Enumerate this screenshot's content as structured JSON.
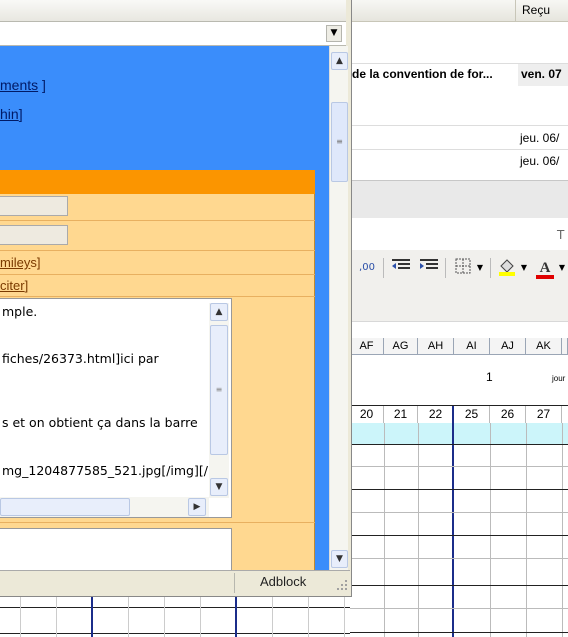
{
  "mail": {
    "col_recu": "Reçu",
    "rows": [
      {
        "subject": "de la convention de for...",
        "date": "ven. 07",
        "bold": true
      },
      {
        "subject": "",
        "date": "jeu. 06/",
        "bold": false
      },
      {
        "subject": "",
        "date": "jeu. 06/",
        "bold": false
      }
    ]
  },
  "spreadsheet": {
    "toolbar_partial_label": "T",
    "columns": [
      "AF",
      "AG",
      "AH",
      "AI",
      "AJ",
      "AK"
    ],
    "row_value": "1",
    "row_value_label": "jour",
    "days": [
      "20",
      "21",
      "22",
      "25",
      "26",
      "27"
    ]
  },
  "dialog": {
    "blue_links": [
      {
        "text": "ments",
        "suffix": " ]"
      },
      {
        "text": "hin",
        "suffix": "]"
      }
    ],
    "orange_links": [
      {
        "text": "miley",
        "suffix": "s]"
      },
      {
        "text": "citer",
        "suffix": "]"
      }
    ],
    "textarea_lines": [
      "mple.",
      "fiches/26373.html]ici par",
      "s et on obtient ça dans la barre",
      "mg_1204877585_521.jpg[/img][/"
    ],
    "status_adblock": "Adblock"
  },
  "colors": {
    "blue_bg": "#3a8dfb",
    "orange_bar": "#fb9500",
    "orange_panel": "#ffd890",
    "cyan_row": "#ccf5fa"
  }
}
